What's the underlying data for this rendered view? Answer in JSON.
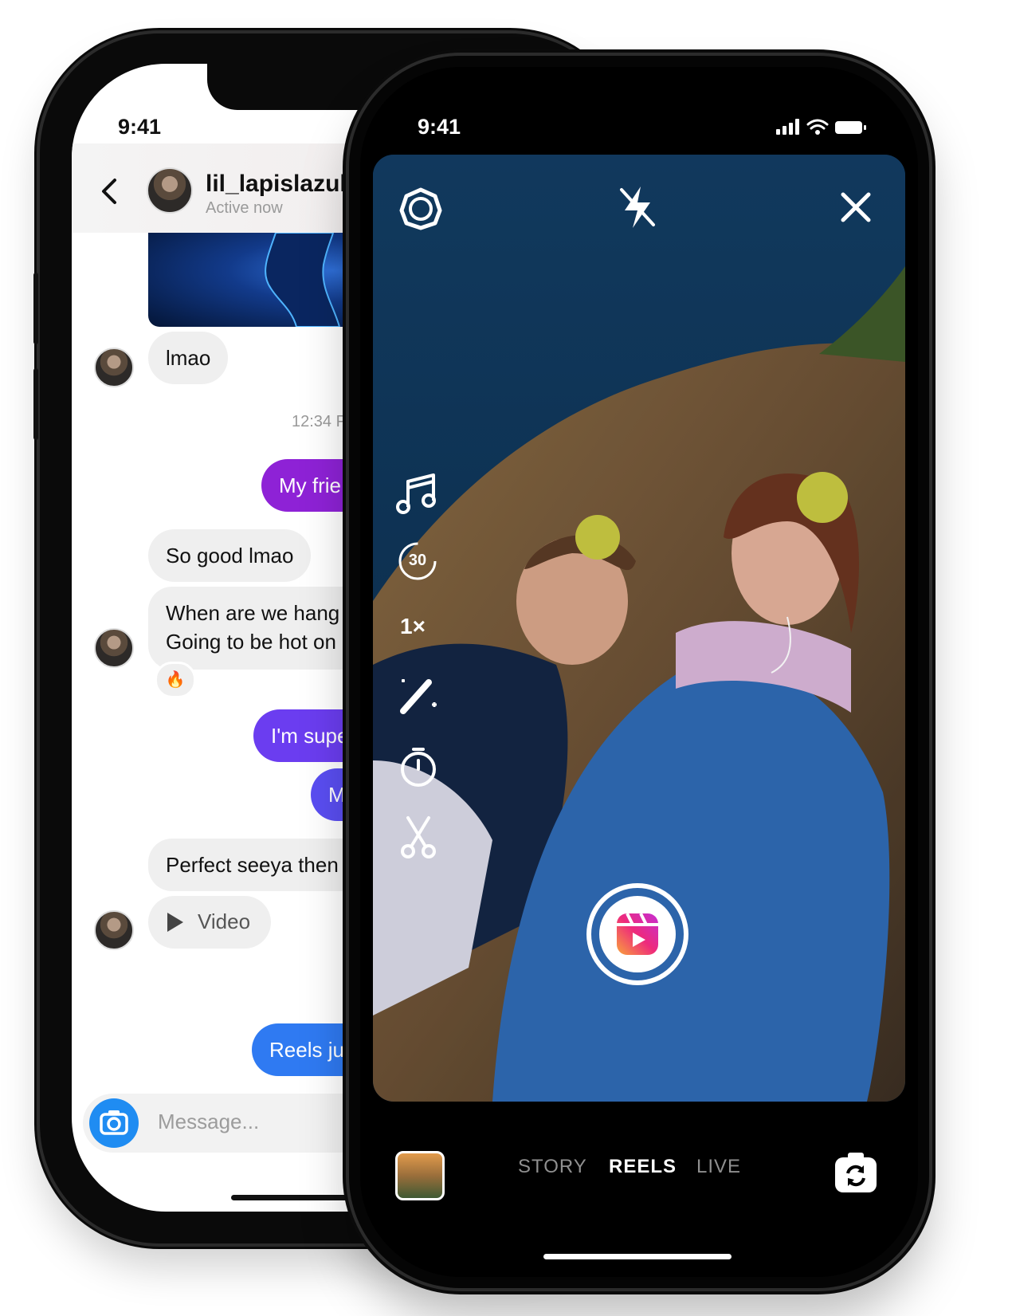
{
  "chat_phone": {
    "status_time": "9:41",
    "header": {
      "name": "lil_lapislazuli",
      "status": "Active now"
    },
    "messages": {
      "lmao": "lmao",
      "timestamp": "12:34 P",
      "my_friend": "My frie",
      "so_good": "So good lmao",
      "when_line1": "When are we hang",
      "when_line2": "Going to be hot on",
      "reaction": "🔥",
      "im_super": "I'm supe",
      "m": "M",
      "perfect": "Perfect seeya then",
      "video": "Video",
      "reels": "Reels ju"
    },
    "composer": {
      "placeholder": "Message..."
    }
  },
  "camera_phone": {
    "status_time": "9:41",
    "side_tools": {
      "timer_duration": "30",
      "speed": "1×"
    },
    "modes": [
      "STORY",
      "REELS",
      "LIVE"
    ],
    "active_mode": "REELS"
  },
  "colors": {
    "purple_bubble": "#8e22d6",
    "violet_bubble": "#6b3df0",
    "blue_bubble": "#2f7af2",
    "camera_button": "#1f8cf2"
  },
  "icons": [
    "back-icon",
    "settings-icon",
    "flash-off-icon",
    "close-icon",
    "music-icon",
    "timer-icon",
    "speed-icon",
    "effects-icon",
    "countdown-icon",
    "trim-icon",
    "reels-icon",
    "flip-camera-icon",
    "camera-icon",
    "play-icon",
    "signal-icon",
    "wifi-icon",
    "battery-icon"
  ]
}
